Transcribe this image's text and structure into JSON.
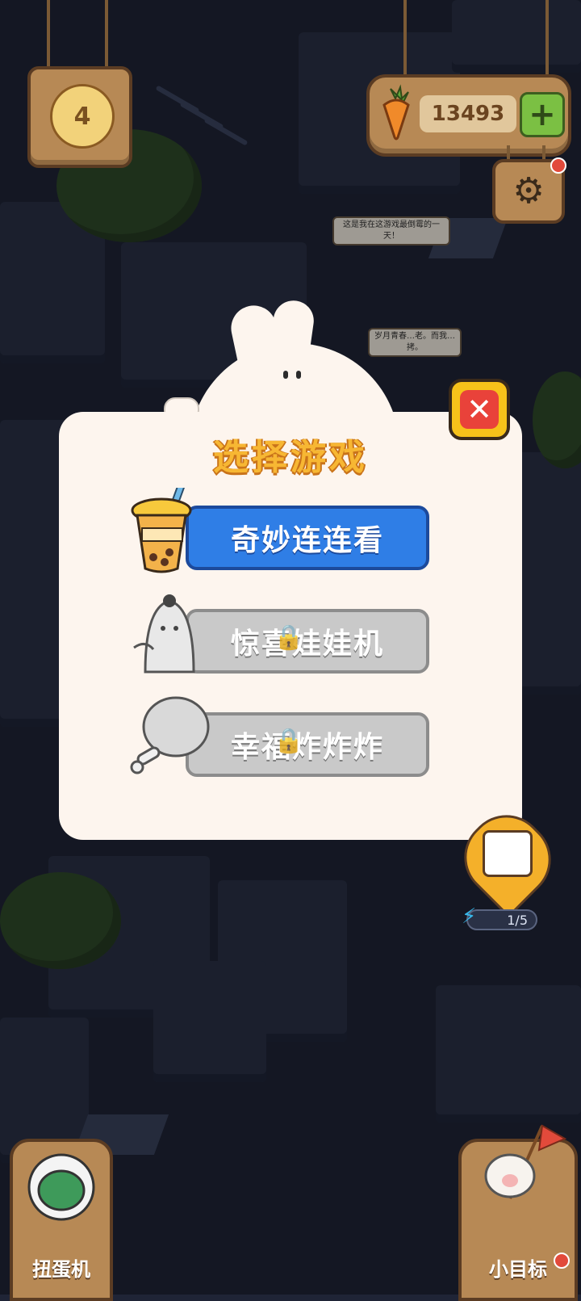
{
  "hud": {
    "level": "4",
    "coins": "13493",
    "coin_icon": "carrot-icon",
    "add_icon": "plus-icon",
    "settings_icon": "gear-icon"
  },
  "bubbles": [
    {
      "text": "这是我在这游戏最倒霉的一天！"
    },
    {
      "text": "岁月青春…老。而我…拷。"
    }
  ],
  "modal": {
    "title": "选择游戏",
    "close_icon": "close-icon",
    "games": [
      {
        "label": "奇妙连连看",
        "state": "unlocked"
      },
      {
        "label": "惊喜娃娃机",
        "state": "locked"
      },
      {
        "label": "幸福炸炸炸",
        "state": "locked"
      }
    ]
  },
  "energy": {
    "value": "1/5"
  },
  "bottom": {
    "left_label": "扭蛋机",
    "right_label": "小目标"
  },
  "colors": {
    "accent": "#2f7ee6",
    "title": "#f7b733",
    "close": "#e9423a",
    "locked": "#c9c9c9",
    "wood": "#b78955"
  }
}
